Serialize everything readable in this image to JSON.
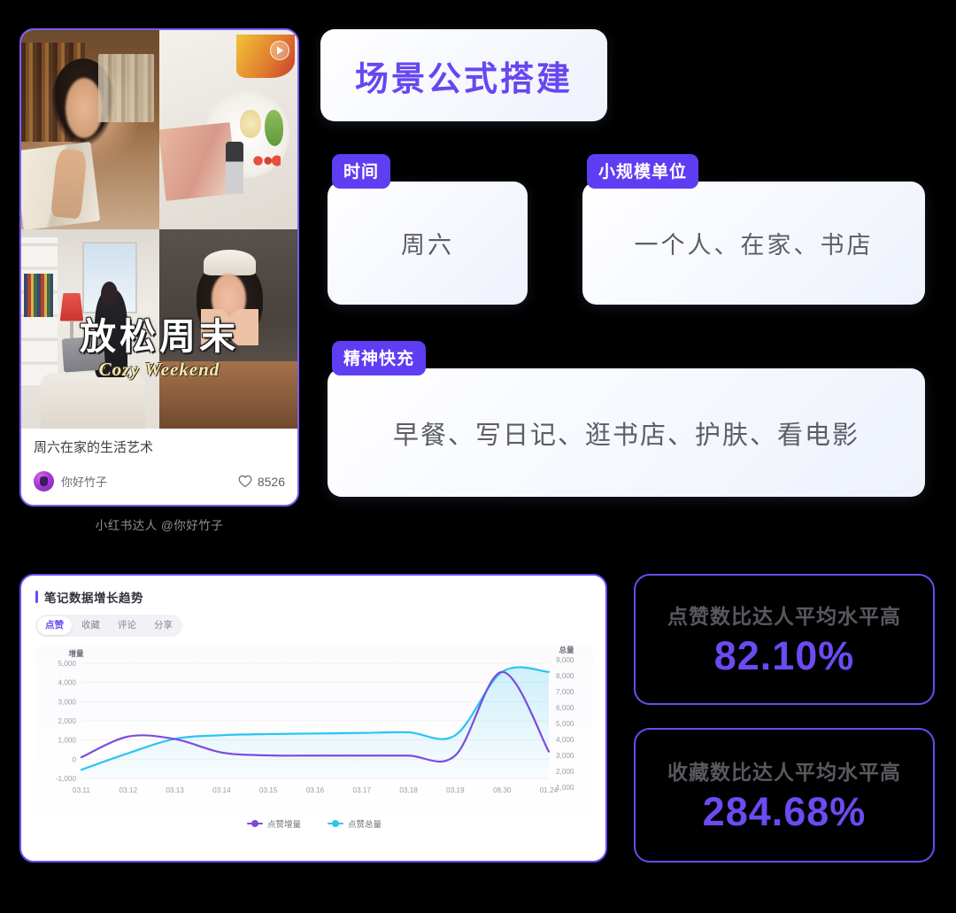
{
  "note": {
    "overlay_cn": "放松周末",
    "overlay_en": "Cozy Weekend",
    "play_icon": "play-icon",
    "title": "周六在家的生活艺术",
    "author": "你好竹子",
    "like_icon": "heart-icon",
    "likes": "8526",
    "caption": "小红书达人 @你好竹子"
  },
  "formula": {
    "title": "场景公式搭建",
    "fields": [
      {
        "badge": "时间",
        "value": "周六"
      },
      {
        "badge": "小规模单位",
        "value": "一个人、在家、书店"
      },
      {
        "badge": "精神快充",
        "value": "早餐、写日记、逛书店、护肤、看电影"
      }
    ]
  },
  "chart_panel": {
    "title": "笔记数据增长趋势",
    "tabs": [
      {
        "label": "点赞",
        "active": true
      },
      {
        "label": "收藏",
        "active": false
      },
      {
        "label": "评论",
        "active": false
      },
      {
        "label": "分享",
        "active": false
      }
    ]
  },
  "stats": [
    {
      "label": "点赞数比达人平均水平高",
      "value": "82.10%"
    },
    {
      "label": "收藏数比达人平均水平高",
      "value": "284.68%"
    }
  ],
  "colors": {
    "background": "#000000",
    "accent_purple": "#6b4bf2",
    "badge_purple": "#5e3df2",
    "series_increment": "#7b4ddb",
    "series_total": "#2bc4f0"
  },
  "chart_data": {
    "type": "line",
    "title": "笔记数据增长趋势",
    "xlabel": "",
    "ylabel": "增量",
    "y2label": "总量",
    "x": [
      "03.11",
      "03.12",
      "03.13",
      "03.14",
      "03.15",
      "03.16",
      "03.17",
      "03.18",
      "03.19",
      "08.30",
      "01.24"
    ],
    "yticks_left": [
      5000,
      4000,
      3000,
      2000,
      1000,
      0,
      -1000
    ],
    "yticks_right": [
      9000,
      8000,
      7000,
      6000,
      5000,
      4000,
      3000,
      2000,
      1000
    ],
    "ylim_left": [
      -1000,
      5000
    ],
    "ylim_right": [
      1000,
      9000
    ],
    "grid": true,
    "legend_position": "bottom",
    "series": [
      {
        "name": "点赞增量",
        "color": "#7b4ddb",
        "axis": "left",
        "values": [
          100,
          1180,
          1050,
          350,
          200,
          190,
          190,
          190,
          200,
          4550,
          400
        ]
      },
      {
        "name": "点赞总量",
        "color": "#2bc4f0",
        "axis": "right",
        "values": [
          1600,
          2750,
          3750,
          4000,
          4080,
          4120,
          4160,
          4200,
          4000,
          8400,
          8400
        ]
      }
    ]
  }
}
